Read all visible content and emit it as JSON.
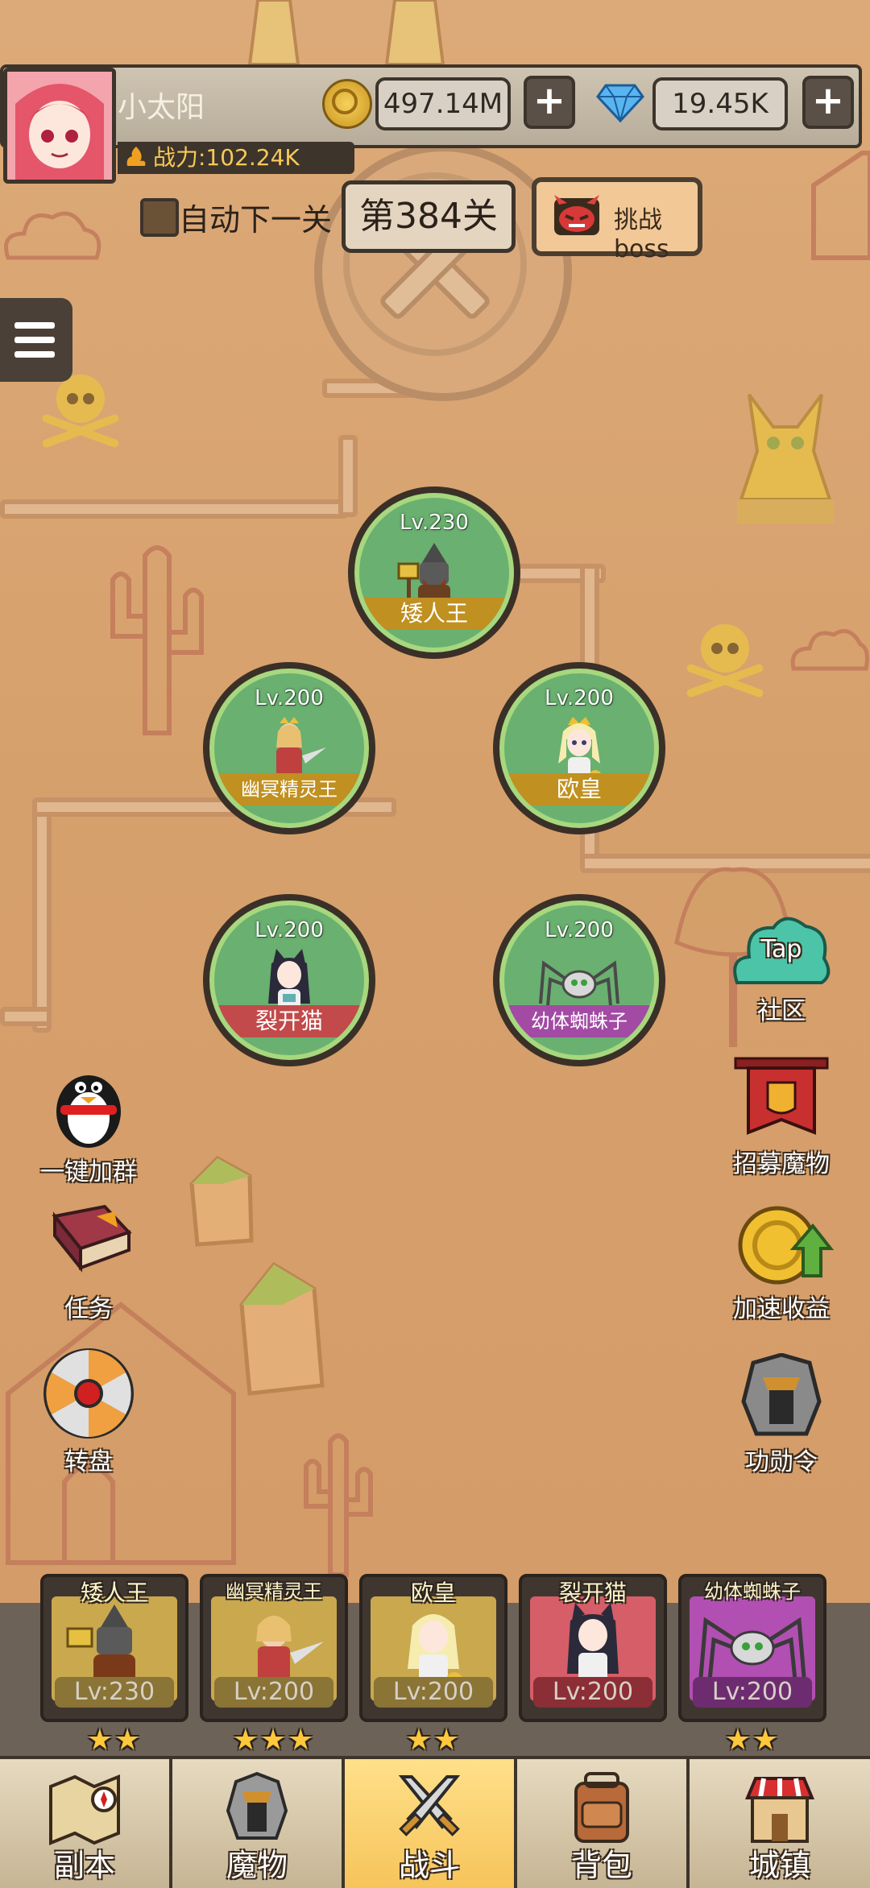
{
  "player": {
    "name": "小太阳",
    "power": "战力:102.24K"
  },
  "currency": {
    "gold": "497.14M",
    "gems": "19.45K",
    "plus": "+"
  },
  "stage": {
    "auto_next_label": "自动下一关",
    "current": "第384关",
    "boss_button": "挑战boss"
  },
  "heroes": [
    {
      "level": "Lv.230",
      "name": "矮人王",
      "band_color": "#c09020"
    },
    {
      "level": "Lv.200",
      "name": "幽冥精灵王",
      "band_color": "#c09020"
    },
    {
      "level": "Lv.200",
      "name": "欧皇",
      "band_color": "#c09020"
    },
    {
      "level": "Lv.200",
      "name": "裂开猫",
      "band_color": "#c24a4a"
    },
    {
      "level": "Lv.200",
      "name": "幼体蜘蛛子",
      "band_color": "#a24aa4"
    }
  ],
  "side_left": [
    {
      "label": "一键加群",
      "icon": "penguin-icon"
    },
    {
      "label": "任务",
      "icon": "quest-book-icon"
    },
    {
      "label": "转盘",
      "icon": "wheel-icon"
    }
  ],
  "side_right": [
    {
      "label": "社区",
      "icon": "tap-cloud-icon",
      "badge": "Tap"
    },
    {
      "label": "招募魔物",
      "icon": "recruit-banner-icon"
    },
    {
      "label": "加速收益",
      "icon": "gold-boost-icon"
    },
    {
      "label": "功勋令",
      "icon": "helmet-icon"
    }
  ],
  "team": [
    {
      "name": "矮人王",
      "level": "Lv:230",
      "stars": "★★",
      "panel_color": "#c9a84e",
      "lv_bg": "#8a7436"
    },
    {
      "name": "幽冥精灵王",
      "level": "Lv:200",
      "stars": "★★★",
      "panel_color": "#c9a84e",
      "lv_bg": "#8a7436"
    },
    {
      "name": "欧皇",
      "level": "Lv:200",
      "stars": "★★",
      "panel_color": "#c9a84e",
      "lv_bg": "#8a7436"
    },
    {
      "name": "裂开猫",
      "level": "Lv:200",
      "stars": "",
      "panel_color": "#d55e68",
      "lv_bg": "#8c2e36"
    },
    {
      "name": "幼体蜘蛛子",
      "level": "Lv:200",
      "stars": "★★",
      "panel_color": "#b24fb2",
      "lv_bg": "#6e2c70"
    }
  ],
  "nav": [
    {
      "label": "副本",
      "icon": "map-icon"
    },
    {
      "label": "魔物",
      "icon": "monster-helmet-icon"
    },
    {
      "label": "战斗",
      "icon": "crossed-swords-icon",
      "active": true
    },
    {
      "label": "背包",
      "icon": "backpack-icon"
    },
    {
      "label": "城镇",
      "icon": "shop-icon"
    }
  ]
}
